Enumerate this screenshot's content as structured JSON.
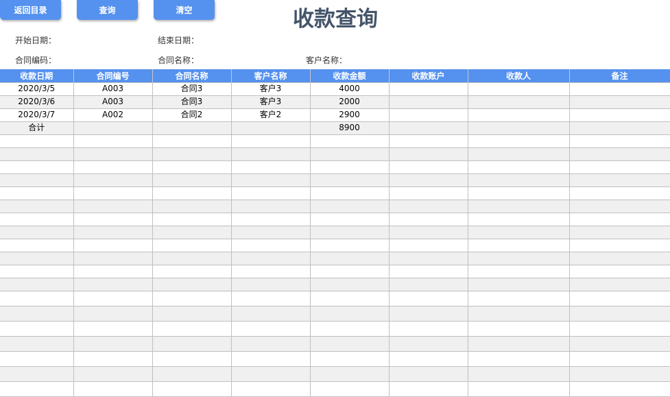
{
  "buttons": {
    "back": "返回目录",
    "query": "查询",
    "clear": "清空"
  },
  "title": "收款查询",
  "filters": {
    "start_date": "开始日期：",
    "end_date": "结束日期：",
    "contract_code": "合同编码：",
    "contract_name": "合同名称：",
    "customer_name": "客户名称："
  },
  "table": {
    "headers": [
      "收款日期",
      "合同编号",
      "合同名称",
      "客户名称",
      "收款金额",
      "收款账户",
      "收款人",
      "备注"
    ],
    "rows": [
      [
        "2020/3/5",
        "A003",
        "合同3",
        "客户3",
        "4000",
        "",
        "",
        ""
      ],
      [
        "2020/3/6",
        "A003",
        "合同3",
        "客户3",
        "2000",
        "",
        "",
        ""
      ],
      [
        "2020/3/7",
        "A002",
        "合同2",
        "客户2",
        "2900",
        "",
        "",
        ""
      ],
      [
        "合计",
        "",
        "",
        "",
        "8900",
        "",
        "",
        ""
      ]
    ]
  }
}
